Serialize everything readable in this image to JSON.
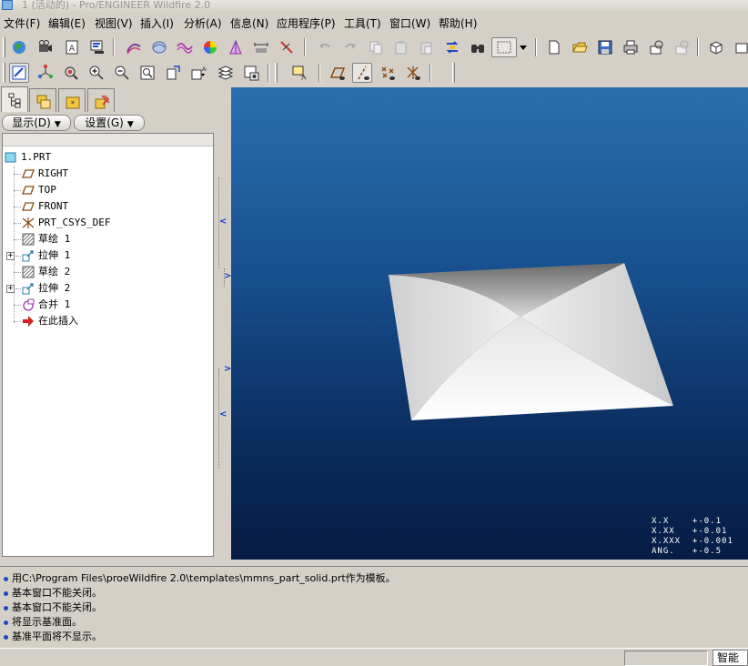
{
  "window": {
    "title": "1 (活动的) - Pro/ENGINEER Wildfire 2.0"
  },
  "menubar": {
    "items": [
      {
        "label": "文件(F)"
      },
      {
        "label": "编辑(E)"
      },
      {
        "label": "视图(V)"
      },
      {
        "label": "插入(I)"
      },
      {
        "label": "分析(A)"
      },
      {
        "label": "信息(N)"
      },
      {
        "label": "应用程序(P)"
      },
      {
        "label": "工具(T)"
      },
      {
        "label": "窗口(W)"
      },
      {
        "label": "帮助(H)"
      }
    ]
  },
  "toolbar1": {
    "buttons": [
      "model-player-icon",
      "video-camera-icon",
      "information-icon",
      "model-display-icon",
      "curve-analysis-icon",
      "surface-analysis-icon",
      "curvature-icon",
      "shading-analysis-icon",
      "draft-analysis-icon",
      "dimension-icon",
      "measure-icon",
      "undo-icon",
      "redo-icon",
      "copy-icon",
      "paste-icon",
      "paste-special-icon",
      "regenerate-icon",
      "find-icon",
      "selection-box-icon",
      "new-file-icon",
      "open-file-icon",
      "save-icon",
      "print-icon",
      "send-mail-icon",
      "send-link-icon",
      "view-cube-icon"
    ]
  },
  "toolbar2": {
    "buttons": [
      "repaint-icon",
      "spin-center-icon",
      "orient-mode-icon",
      "zoom-in-icon",
      "zoom-out-icon",
      "refit-icon",
      "reorient-icon",
      "saved-views-icon",
      "layers-icon",
      "view-manager-icon",
      "model-display-mode-icon",
      "datum-plane-toggle-icon",
      "datum-axis-toggle-icon",
      "datum-point-toggle-icon",
      "coordinate-system-toggle-icon"
    ]
  },
  "navigator": {
    "tabs": [
      "model-tree-icon",
      "folder-browser-icon",
      "favorites-icon",
      "connections-icon"
    ],
    "active_tab": 0,
    "show_button": "显示(D)",
    "settings_button": "设置(G)"
  },
  "model_tree": {
    "root": "1.PRT",
    "items": [
      {
        "label": "RIGHT",
        "icon": "datum-plane-icon",
        "expandable": false
      },
      {
        "label": "TOP",
        "icon": "datum-plane-icon",
        "expandable": false
      },
      {
        "label": "FRONT",
        "icon": "datum-plane-icon",
        "expandable": false
      },
      {
        "label": "PRT_CSYS_DEF",
        "icon": "coordinate-system-icon",
        "expandable": false
      },
      {
        "label": "草绘 1",
        "icon": "sketch-icon",
        "expandable": false
      },
      {
        "label": "拉伸 1",
        "icon": "extrude-icon",
        "expandable": true
      },
      {
        "label": "草绘 2",
        "icon": "sketch-icon",
        "expandable": false
      },
      {
        "label": "拉伸 2",
        "icon": "extrude-icon",
        "expandable": true
      },
      {
        "label": "合并 1",
        "icon": "merge-icon",
        "expandable": false
      },
      {
        "label": "在此插入",
        "icon": "insert-here-arrow-icon",
        "expandable": false
      }
    ]
  },
  "viewport": {
    "background_top": "#2a6fb0",
    "background_bottom": "#061c44",
    "tolerances": [
      "X.X    +-0.1",
      "X.XX   +-0.01",
      "X.XXX  +-0.001",
      "ANG.   +-0.5"
    ]
  },
  "messages": [
    "用C:\\Program Files\\proeWildfire 2.0\\templates\\mmns_part_solid.prt作为模板。",
    "基本窗口不能关闭。",
    "基本窗口不能关闭。",
    "将显示基准面。",
    "基准平面将不显示。"
  ],
  "status": {
    "filter_value": "智能"
  },
  "colors": {
    "chrome": "#d4d0c8",
    "message_bullet": "#1f48c6",
    "arrow_blue": "#1a3cc8"
  }
}
